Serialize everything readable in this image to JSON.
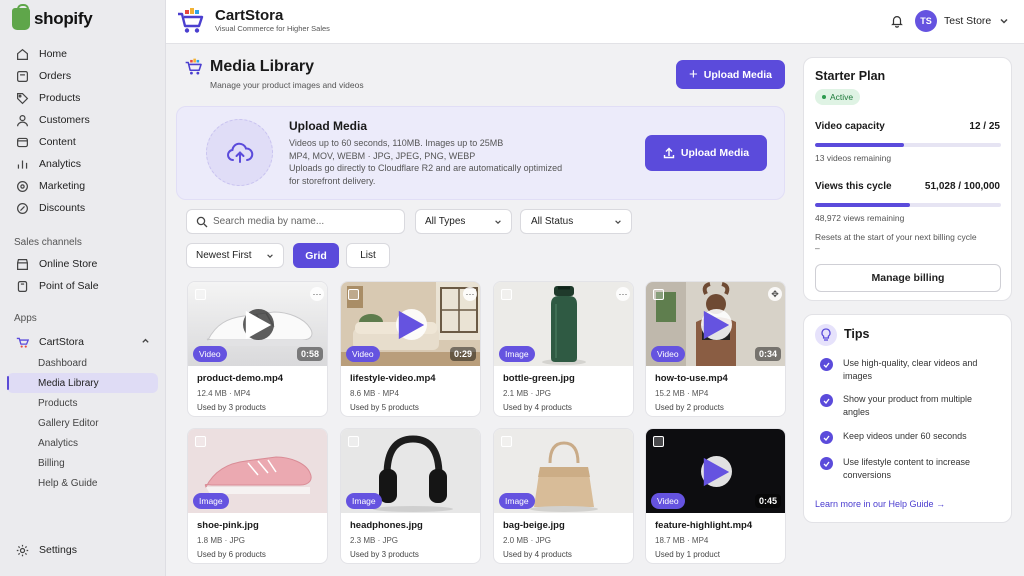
{
  "sidebar": {
    "logo": "shopify",
    "nav": [
      {
        "label": "Home",
        "icon": "home-icon"
      },
      {
        "label": "Orders",
        "icon": "orders-icon"
      },
      {
        "label": "Products",
        "icon": "tag-icon"
      },
      {
        "label": "Customers",
        "icon": "person-icon"
      },
      {
        "label": "Content",
        "icon": "content-icon"
      },
      {
        "label": "Analytics",
        "icon": "analytics-icon"
      },
      {
        "label": "Marketing",
        "icon": "marketing-icon"
      },
      {
        "label": "Discounts",
        "icon": "discount-icon"
      }
    ],
    "sales_channels_title": "Sales channels",
    "channels": [
      {
        "label": "Online Store",
        "icon": "store-icon"
      },
      {
        "label": "Point of Sale",
        "icon": "pos-icon"
      }
    ],
    "apps_title": "Apps",
    "app_name": "CartStora",
    "app_items": [
      "Dashboard",
      "Media Library",
      "Products",
      "Gallery Editor",
      "Analytics",
      "Billing",
      "Help & Guide"
    ],
    "settings": "Settings"
  },
  "topbar": {
    "brand": "CartStora",
    "tagline": "Visual Commerce for Higher Sales",
    "avatar_initials": "TS",
    "store_name": "Test Store"
  },
  "main": {
    "title": "Media Library",
    "subtitle": "Manage your product images and videos",
    "upload_button": "Upload Media",
    "upload_card": {
      "title": "Upload Media",
      "lines": [
        "Videos up to 60 seconds, 110MB. Images up to 25MB",
        "MP4, MOV, WEBM · JPG, JPEG, PNG, WEBP",
        "Uploads go directly to Cloudflare R2 and are automatically optimized",
        "for storefront delivery."
      ],
      "button": "Upload Media"
    },
    "search_placeholder": "Search media by name...",
    "type_filter": "All Types",
    "status_filter": "All Status",
    "sort": "Newest First",
    "view_grid": "Grid",
    "view_list": "List",
    "media": [
      {
        "name": "product-demo.mp4",
        "meta": "12.4 MB · MP4",
        "used": "Used by 3 products",
        "type": "Video",
        "duration": "0:58",
        "thumb": "white-sneaker"
      },
      {
        "name": "lifestyle-video.mp4",
        "meta": "8.6 MB · MP4",
        "used": "Used by 5 products",
        "type": "Video",
        "duration": "0:29",
        "thumb": "living-room"
      },
      {
        "name": "bottle-green.jpg",
        "meta": "2.1 MB · JPG",
        "used": "Used by 4 products",
        "type": "Image",
        "duration": "",
        "thumb": "green-bottle"
      },
      {
        "name": "how-to-use.mp4",
        "meta": "15.2 MB · MP4",
        "used": "Used by 2 products",
        "type": "Video",
        "duration": "0:34",
        "thumb": "woman-workout"
      },
      {
        "name": "shoe-pink.jpg",
        "meta": "1.8 MB · JPG",
        "used": "Used by 6 products",
        "type": "Image",
        "duration": "",
        "thumb": "pink-sneaker"
      },
      {
        "name": "headphones.jpg",
        "meta": "2.3 MB · JPG",
        "used": "Used by 3 products",
        "type": "Image",
        "duration": "",
        "thumb": "headphones"
      },
      {
        "name": "bag-beige.jpg",
        "meta": "2.0 MB · JPG",
        "used": "Used by 4 products",
        "type": "Image",
        "duration": "",
        "thumb": "beige-bag"
      },
      {
        "name": "feature-highlight.mp4",
        "meta": "18.7 MB · MP4",
        "used": "Used by 1 product",
        "type": "Video",
        "duration": "0:45",
        "thumb": "dark-video"
      }
    ]
  },
  "plan": {
    "title": "Starter Plan",
    "status": "Active",
    "video_label": "Video capacity",
    "video_value": "12 / 25",
    "video_fraction": 0.48,
    "video_remaining": "13 videos remaining",
    "views_label": "Views this cycle",
    "views_value": "51,028 / 100,000",
    "views_fraction": 0.51,
    "views_remaining": "48,972 views remaining",
    "reset_note": "Resets at the start of your next billing cycle",
    "reset_dash": "–",
    "manage_button": "Manage billing"
  },
  "tips": {
    "title": "Tips",
    "items": [
      "Use high-quality, clear videos and images",
      "Show your product from multiple angles",
      "Keep videos under 60 seconds",
      "Use lifestyle content to increase conversions"
    ],
    "link": "Learn more in our Help Guide →"
  },
  "colors": {
    "accent": "#5b4bdb",
    "success": "#2c9a4e",
    "shopify_green": "#5fa64a"
  }
}
